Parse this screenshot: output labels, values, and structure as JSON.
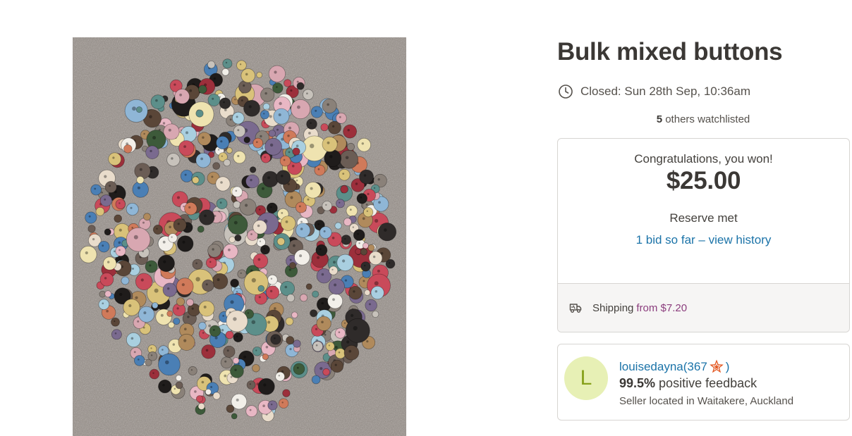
{
  "listing": {
    "title": "Bulk mixed buttons",
    "photo_alt": "Bulk mixed buttons",
    "closed_text": "Closed: Sun 28th Sep, 10:36am",
    "closed_icon": "clock-icon",
    "watchlist_count": "5",
    "watchlist_suffix": " others watchlisted"
  },
  "bid_panel": {
    "congrats": "Congratulations, you won!",
    "price": "$25.00",
    "reserve": "Reserve met",
    "bids_link": "1 bid so far – view history",
    "shipping_label": "Shipping",
    "shipping_from": "from $7.20",
    "shipping_icon": "truck-icon"
  },
  "seller": {
    "avatar_letter": "L",
    "name": "louisedayna",
    "rating_open": " (367",
    "rating_close": ")",
    "rating_icon": "star-badge-icon",
    "feedback_pct": "99.5%",
    "feedback_suffix": " positive feedback",
    "location": "Seller located in Waitakere, Auckland"
  },
  "colors": {
    "link": "#1b73a8",
    "shipping_accent": "#8b3d7d",
    "avatar_bg": "#e7f0b5",
    "avatar_text": "#87a11b",
    "carpet": "#8e8882"
  }
}
